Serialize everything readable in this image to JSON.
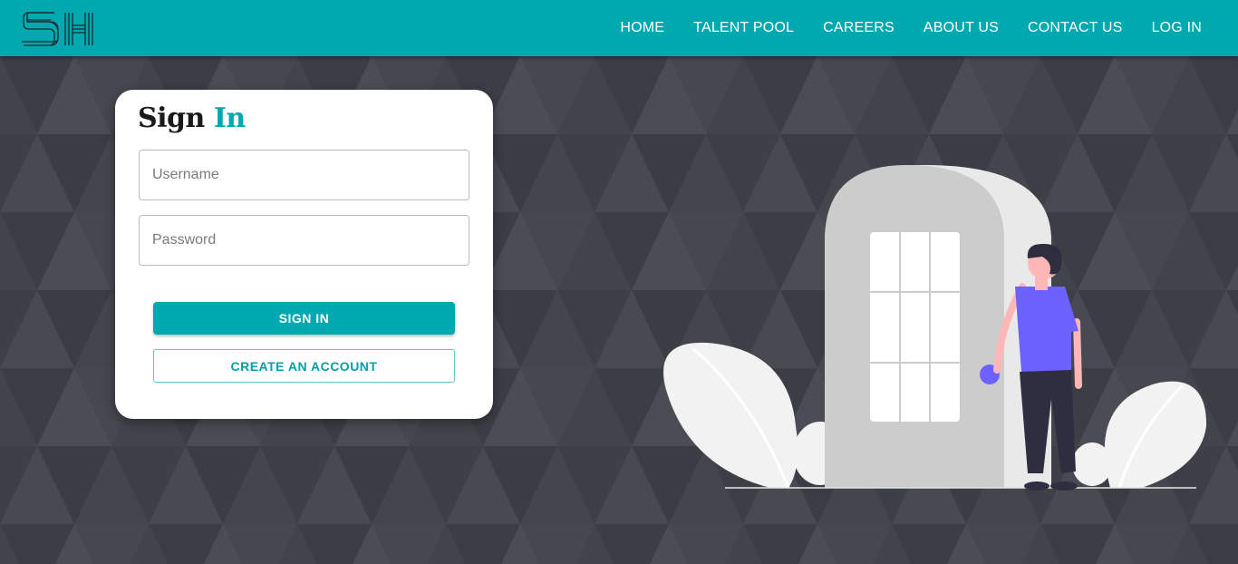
{
  "brand": {
    "logo_text": "SH",
    "accent_color": "#00a8b0"
  },
  "nav": {
    "items": [
      {
        "label": "HOME"
      },
      {
        "label": "TALENT POOL"
      },
      {
        "label": "CAREERS"
      },
      {
        "label": "ABOUT US"
      },
      {
        "label": "CONTACT US"
      },
      {
        "label": "LOG IN"
      }
    ]
  },
  "signin": {
    "title_main": "Sign",
    "title_accent": "In",
    "username": {
      "placeholder": "Username",
      "value": ""
    },
    "password": {
      "placeholder": "Password",
      "value": ""
    },
    "submit_label": "SIGN IN",
    "create_label": "CREATE AN ACCOUNT"
  },
  "illustration": {
    "name": "person-at-door-illustration",
    "shirt_color": "#6c63ff"
  }
}
